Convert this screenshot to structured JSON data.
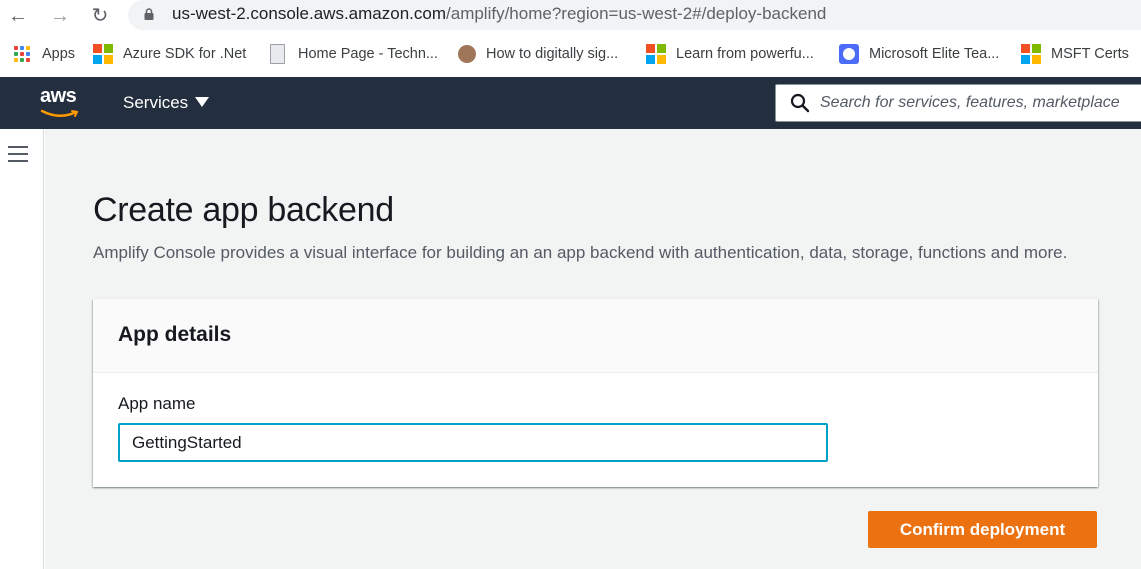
{
  "browser": {
    "url_host": "us-west-2.console.aws.amazon.com",
    "url_path": "/amplify/home?region=us-west-2#/deploy-backend"
  },
  "bookmarks": [
    {
      "label": "Apps",
      "icon": "apps-grid-icon"
    },
    {
      "label": "Azure SDK for .Net",
      "icon": "microsoft-logo-icon"
    },
    {
      "label": "Home Page - Techn...",
      "icon": "document-icon"
    },
    {
      "label": "How to digitally sig...",
      "icon": "avatar-icon"
    },
    {
      "label": "Learn from powerfu...",
      "icon": "microsoft-logo-icon"
    },
    {
      "label": "Microsoft Elite Tea...",
      "icon": "check-badge-icon"
    },
    {
      "label": "MSFT Certs",
      "icon": "microsoft-logo-icon"
    }
  ],
  "aws_header": {
    "logo_text": "aws",
    "services_label": "Services",
    "search_placeholder": "Search for services, features, marketplace"
  },
  "page": {
    "title": "Create app backend",
    "description": "Amplify Console provides a visual interface for building an an app backend with authentication, data, storage, functions and more."
  },
  "app_details": {
    "title": "App details",
    "app_name_label": "App name",
    "app_name_value": "GettingStarted"
  },
  "actions": {
    "confirm_label": "Confirm deployment"
  },
  "colors": {
    "aws_header_bg": "#232f3e",
    "primary_button": "#ec7211",
    "focus_border": "#00a1c9",
    "aws_smile": "#ff9900"
  }
}
